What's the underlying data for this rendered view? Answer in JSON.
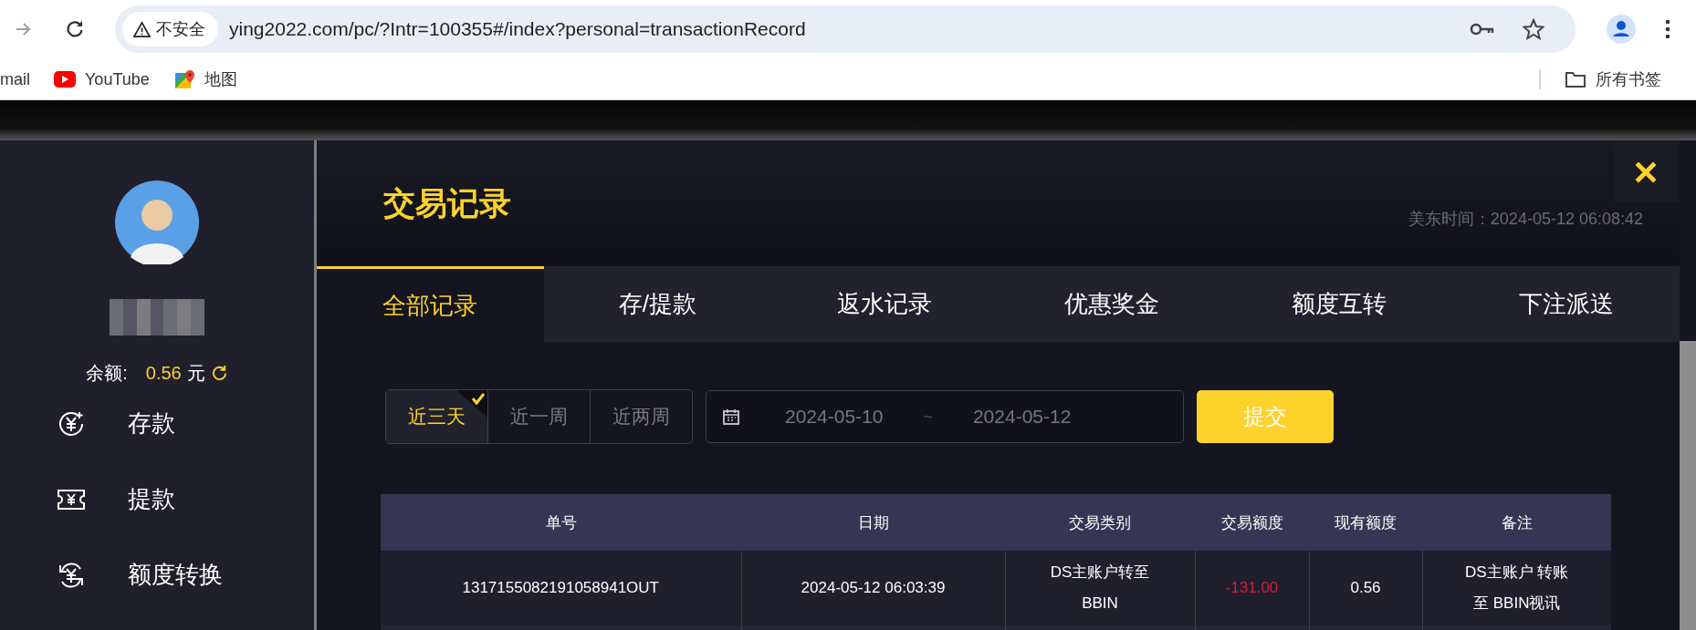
{
  "browser": {
    "address": {
      "security": "不安全",
      "url": "ying2022.com/pc/?Intr=100355#/index?personal=transactionRecord"
    },
    "bookmarks": [
      {
        "kind": "mail",
        "label": "mail"
      },
      {
        "kind": "video",
        "label": "YouTube"
      },
      {
        "kind": "map",
        "label": "地图"
      }
    ],
    "all_bookmarks": "所有书签"
  },
  "sidebar": {
    "balance_label": "余额:",
    "balance_value": "0.56",
    "currency": "元",
    "menu": [
      {
        "kind": "deposit",
        "label": "存款"
      },
      {
        "kind": "withdraw",
        "label": "提款"
      },
      {
        "kind": "transfer",
        "label": "额度转换"
      }
    ]
  },
  "panel": {
    "title": "交易记录",
    "time": "美东时间：2024-05-12 06:08:42",
    "tabs": [
      {
        "label": "全部记录",
        "selected": true
      },
      {
        "label": "存/提款",
        "selected": false
      },
      {
        "label": "返水记录",
        "selected": false
      },
      {
        "label": "优惠奖金",
        "selected": false
      },
      {
        "label": "额度互转",
        "selected": false
      },
      {
        "label": "下注派送",
        "selected": false
      }
    ],
    "ranges": [
      {
        "label": "近三天",
        "selected": true
      },
      {
        "label": "近一周",
        "selected": false
      },
      {
        "label": "近两周",
        "selected": false
      }
    ],
    "date_from": "2024-05-10",
    "date_separator": "~",
    "date_to": "2024-05-12",
    "submit": "提交",
    "table": {
      "columns": [
        "单号",
        "日期",
        "交易类别",
        "交易额度",
        "现有额度",
        "备注"
      ],
      "rows": [
        {
          "cells": [
            "1317155082191058941OUT",
            "2024-05-12 06:03:39",
            "DS主账户转至BBIN",
            "-131.00",
            "0.56",
            "DS主账户 转账至 BBIN视讯"
          ],
          "negative": true
        }
      ]
    }
  }
}
